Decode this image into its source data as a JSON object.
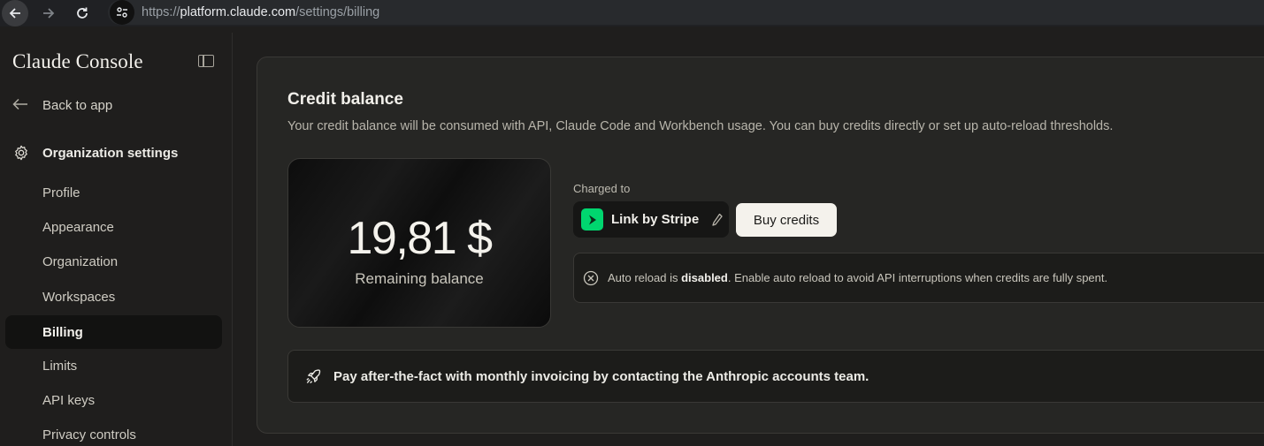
{
  "browser": {
    "url_prefix": "https://",
    "url_host": "platform.claude.com",
    "url_path": "/settings/billing"
  },
  "sidebar": {
    "brand": "Claude Console",
    "back_label": "Back to app",
    "section_title": "Organization settings",
    "items": [
      {
        "label": "Profile",
        "active": false
      },
      {
        "label": "Appearance",
        "active": false
      },
      {
        "label": "Organization",
        "active": false
      },
      {
        "label": "Workspaces",
        "active": false
      },
      {
        "label": "Billing",
        "active": true
      },
      {
        "label": "Limits",
        "active": false
      },
      {
        "label": "API keys",
        "active": false
      },
      {
        "label": "Privacy controls",
        "active": false
      }
    ]
  },
  "credit": {
    "title": "Credit balance",
    "description": "Your credit balance will be consumed with API, Claude Code and Workbench usage. You can buy credits directly or set up auto-reload thresholds.",
    "amount": "19,81 $",
    "amount_label": "Remaining balance",
    "charged_to_label": "Charged to",
    "payment_method": "Link by Stripe",
    "buy_button": "Buy credits",
    "auto_reload_prefix": "Auto reload is ",
    "auto_reload_status": "disabled",
    "auto_reload_suffix": ". Enable auto reload to avoid API interruptions when credits are fully spent.",
    "invoice_text": "Pay after-the-fact with monthly invoicing by contacting the Anthropic accounts team."
  },
  "colors": {
    "background": "#1f1e1d",
    "card": "#262624",
    "stripe_green": "#00d66f",
    "button_light": "#f4f2ec"
  }
}
